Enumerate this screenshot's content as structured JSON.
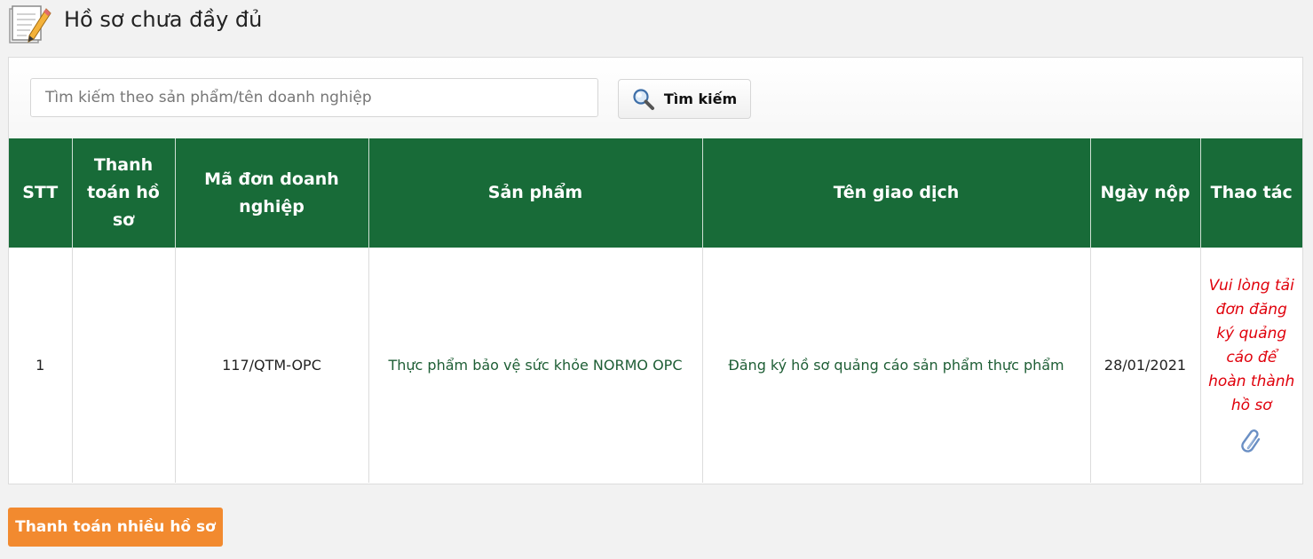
{
  "header": {
    "title": "Hồ sơ chưa đầy đủ",
    "icon": "document-edit-icon"
  },
  "search": {
    "placeholder": "Tìm kiếm theo sản phẩm/tên doanh nghiệp",
    "value": "",
    "button_label": "Tìm kiếm",
    "button_icon": "magnifier-icon"
  },
  "table": {
    "header_color": "#186b38",
    "columns": [
      "STT",
      "Thanh toán hồ sơ",
      "Mã đơn doanh nghiệp",
      "Sản phẩm",
      "Tên giao dịch",
      "Ngày nộp",
      "Thao tác"
    ],
    "rows": [
      {
        "stt": "1",
        "payment": "",
        "code": "117/QTM-OPC",
        "product": "Thực phẩm bảo vệ sức khỏe NORMO OPC",
        "transaction": "Đăng ký hồ sơ quảng cáo sản phẩm thực phẩm",
        "date": "28/01/2021",
        "action_note": "Vui lòng tải đơn đăng ký quảng cáo để hoàn thành hồ sơ",
        "action_icon": "paperclip-icon"
      }
    ]
  },
  "footer": {
    "pay_many_label": "Thanh toán nhiều hồ sơ",
    "pay_many_color": "#f28a2f"
  }
}
